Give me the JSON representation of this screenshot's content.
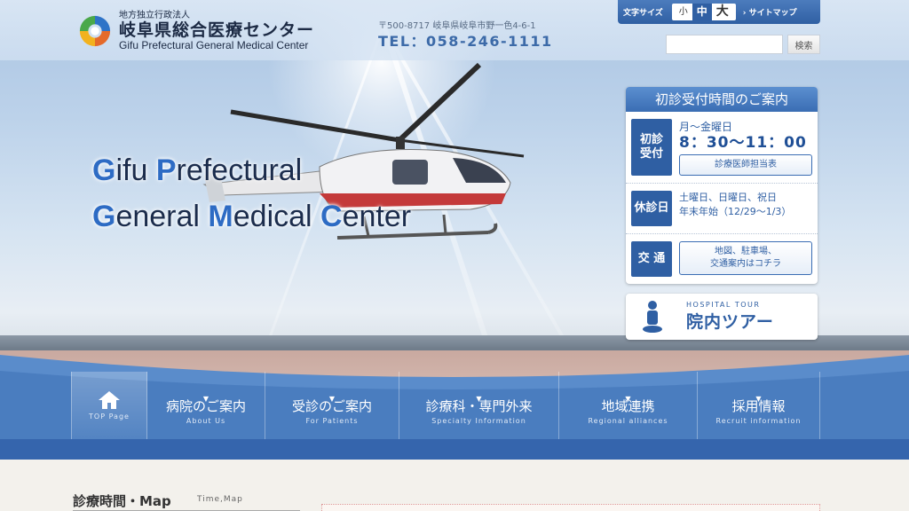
{
  "header": {
    "logo_sub": "地方独立行政法人",
    "logo_main": "岐阜県総合医療センター",
    "logo_en": "Gifu Prefectural General Medical Center",
    "address": "〒500-8717 岐阜県岐阜市野一色4-6-1",
    "tel": "TEL：058-246-1111"
  },
  "toolbar": {
    "font_size_label": "文字サイズ",
    "small": "小",
    "medium": "中",
    "large": "大",
    "sitemap": "サイトマップ",
    "search_placeholder": "",
    "search_button": "検索"
  },
  "hero": {
    "line1_cap1": "G",
    "line1_rest1": "ifu ",
    "line1_cap2": "P",
    "line1_rest2": "refectural",
    "line2_cap1": "G",
    "line2_rest1": "eneral ",
    "line2_cap2": "M",
    "line2_rest2": "edical ",
    "line2_cap3": "C",
    "line2_rest3": "enter"
  },
  "info": {
    "title": "初診受付時間のご案内",
    "reception_badge_1": "初診",
    "reception_badge_2": "受付",
    "reception_days": "月〜金曜日",
    "reception_time": "8：30〜11：00",
    "doctor_link": "診療医師担当表",
    "closed_badge": "休診日",
    "closed_line1": "土曜日、日曜日、祝日",
    "closed_line2": "年末年始（12/29〜1/3）",
    "access_badge": "交 通",
    "access_line1": "地図、駐車場、",
    "access_line2": "交通案内はコチラ"
  },
  "tour": {
    "en": "HOSPITAL TOUR",
    "ja": "院内ツアー"
  },
  "nav": {
    "items": [
      {
        "ja": "",
        "en": "TOP Page"
      },
      {
        "ja": "病院のご案内",
        "en": "About Us"
      },
      {
        "ja": "受診のご案内",
        "en": "For Patients"
      },
      {
        "ja": "診療科・専門外来",
        "en": "Specialty Information"
      },
      {
        "ja": "地域連携",
        "en": "Regional alliances"
      },
      {
        "ja": "採用情報",
        "en": "Recruit information"
      }
    ]
  },
  "section": {
    "title": "診療時間・Map",
    "en": "Time,Map"
  },
  "colors": {
    "primary": "#2f5fa3",
    "accent": "#3a6db3",
    "nav_bg": "#4b7fc0"
  },
  "icons": {
    "home": "home-icon",
    "person": "person-icon",
    "arrow": "chevron-right-icon"
  }
}
